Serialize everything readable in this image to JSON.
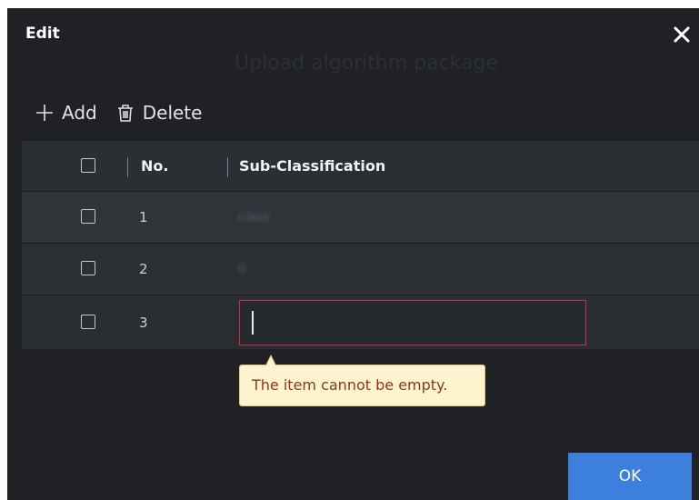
{
  "dialog": {
    "title": "Edit",
    "background_text": "Upload algorithm package"
  },
  "toolbar": {
    "add_label": "Add",
    "delete_label": "Delete"
  },
  "table": {
    "columns": [
      "No.",
      "Sub-Classification"
    ],
    "rows": [
      {
        "no": "1",
        "sub_classification": "class"
      },
      {
        "no": "2",
        "sub_classification": "0"
      },
      {
        "no": "3",
        "sub_classification": ""
      }
    ]
  },
  "validation": {
    "message": "The item cannot be empty."
  },
  "footer": {
    "ok_label": "OK"
  },
  "colors": {
    "dialog_bg": "#1f2124",
    "accent": "#3c7fdc",
    "error_border": "#c8323a",
    "tooltip_bg": "#fff3cf"
  }
}
